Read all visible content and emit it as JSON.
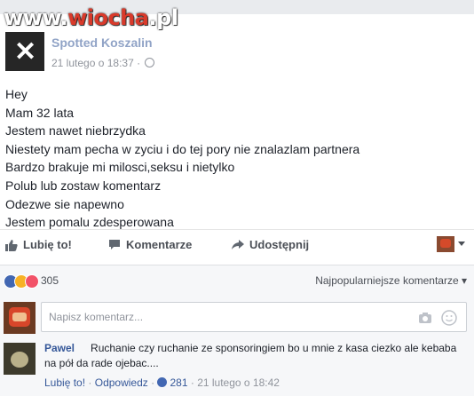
{
  "watermark": {
    "part1": "www.",
    "part2": "wiocha",
    "part3": ".pl"
  },
  "post": {
    "page_avatar_text": "Spotted\nKoszalin",
    "page_name": "Spotted Koszalin",
    "timestamp": "21 lutego o 18:37",
    "separator": "·",
    "lines": [
      "Hey",
      "Mam 32 lata",
      "Jestem nawet niebrzydka",
      "Niestety mam pecha w zyciu i do tej pory nie znalazlam partnera",
      "Bardzo brakuje mi milosci,seksu i nietylko",
      "Polub lub zostaw komentarz",
      "Odezwe sie napewno",
      "Jestem pomalu zdesperowana"
    ]
  },
  "actions": {
    "like": "Lubię to!",
    "comment": "Komentarze",
    "share": "Udostępnij"
  },
  "reactions": {
    "count": "305",
    "sort_label": "Najpopularniejsze komentarze"
  },
  "comment_box": {
    "placeholder": "Napisz komentarz..."
  },
  "comments": [
    {
      "author": "Pawel",
      "text": "Ruchanie czy ruchanie ze sponsoringiem bo u mnie z kasa ciezko ale kebaba na pół da rade ojebac....",
      "like_label": "Lubię to!",
      "reply_label": "Odpowiedz",
      "likes": "281",
      "time": "21 lutego o 18:42"
    }
  ],
  "colors": {
    "link": "#365899",
    "like_blue": "#4267b2",
    "background": "#e9ebee"
  }
}
